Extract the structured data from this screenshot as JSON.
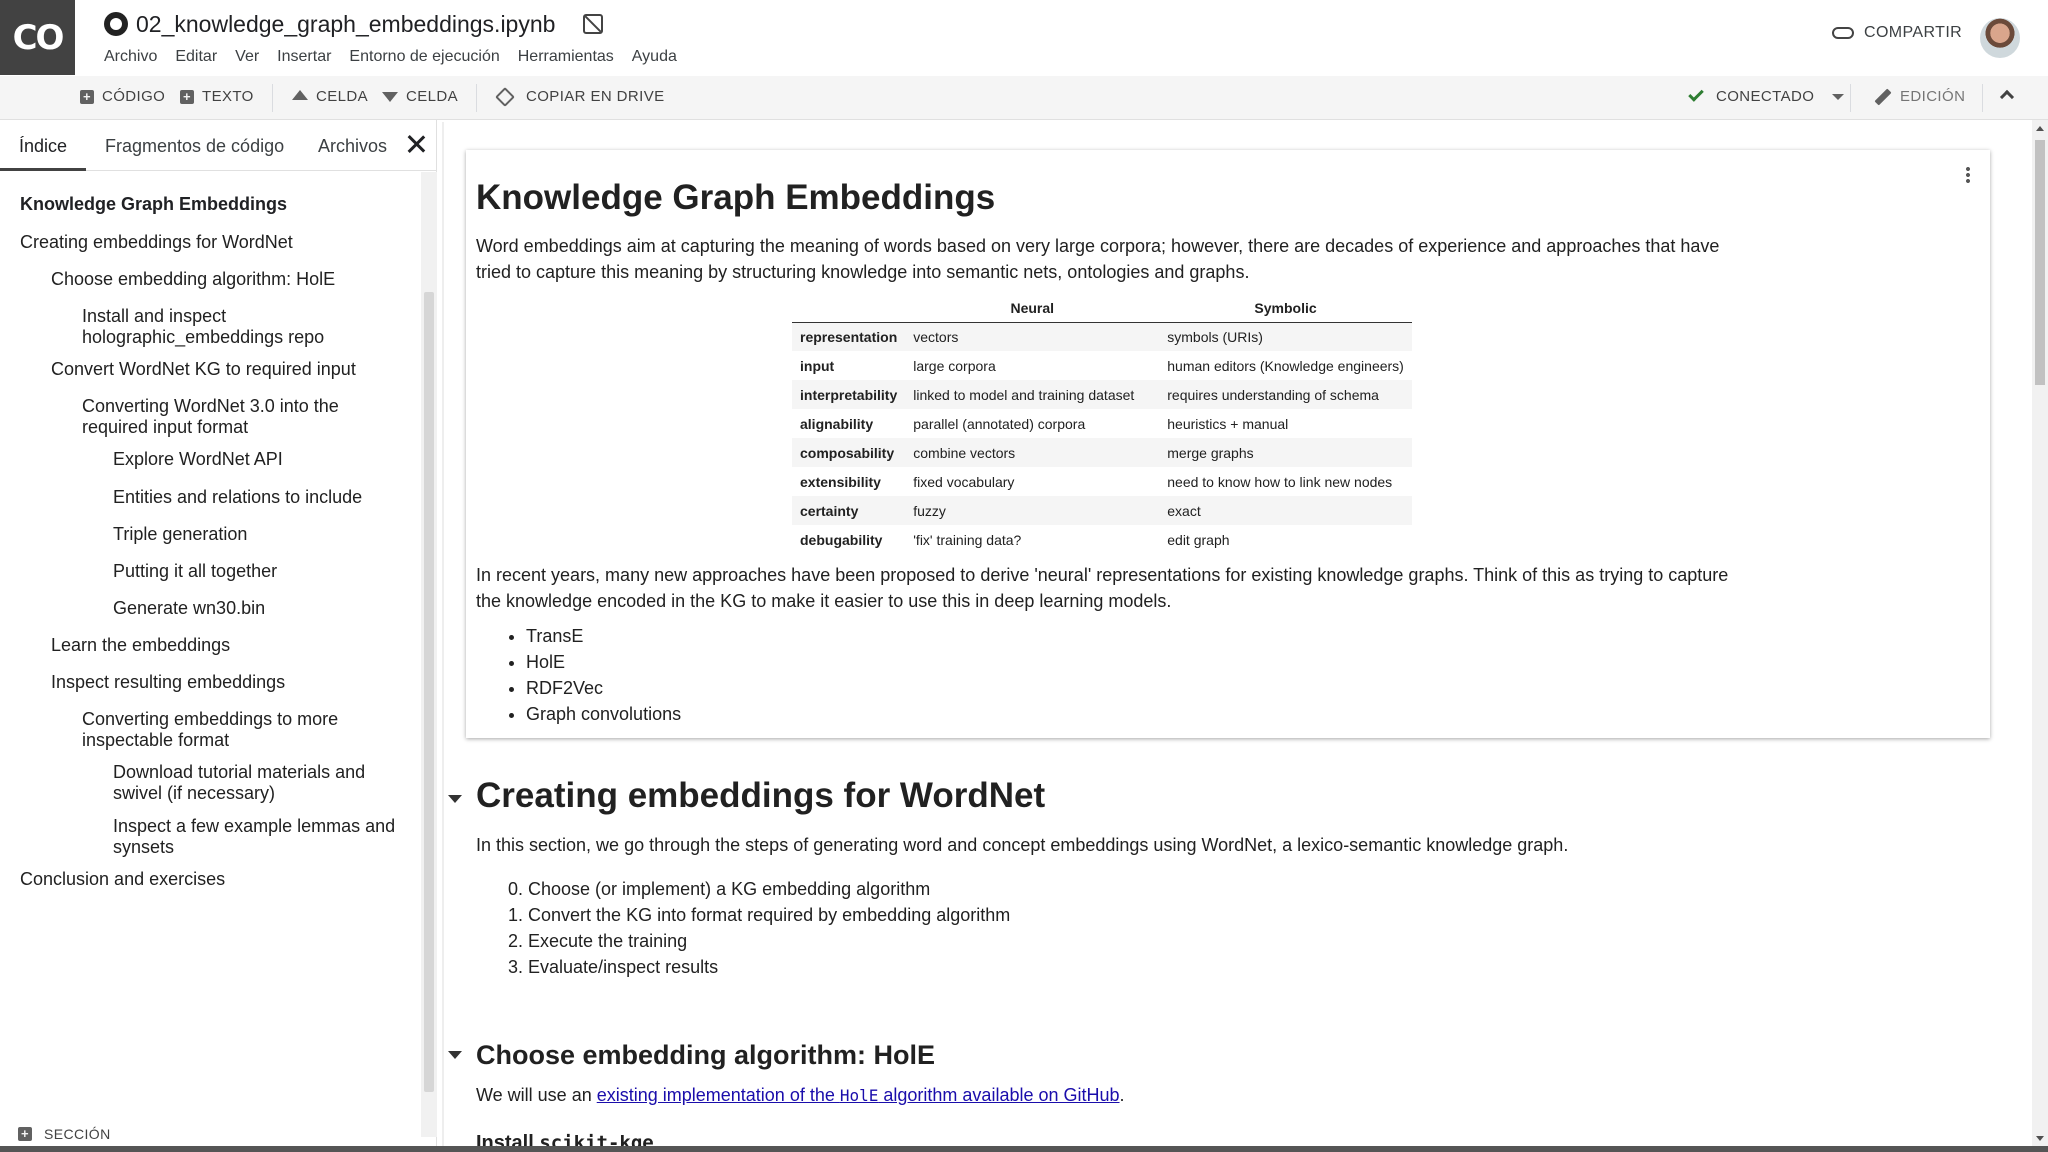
{
  "header": {
    "logo": "CO",
    "notebook_title": "02_knowledge_graph_embeddings.ipynb",
    "menu": [
      "Archivo",
      "Editar",
      "Ver",
      "Insertar",
      "Entorno de ejecución",
      "Herramientas",
      "Ayuda"
    ],
    "share_label": "COMPARTIR"
  },
  "toolbar": {
    "code_label": "CÓDIGO",
    "text_label": "TEXTO",
    "cell_up_label": "CELDA",
    "cell_down_label": "CELDA",
    "copy_drive_label": "COPIAR EN DRIVE",
    "connected_label": "CONECTADO",
    "edit_label": "EDICIÓN"
  },
  "sidebar": {
    "tabs": [
      "Índice",
      "Fragmentos de código",
      "Archivos"
    ],
    "toc": [
      {
        "label": "Knowledge Graph Embeddings",
        "level": 0,
        "bold": true
      },
      {
        "label": "Creating embeddings for WordNet",
        "level": 0
      },
      {
        "label": "Choose embedding algorithm: HolE",
        "level": 1
      },
      {
        "label": "Install and inspect holographic_embeddings repo",
        "level": 2
      },
      {
        "label": "Convert WordNet KG to required input",
        "level": 1
      },
      {
        "label": "Converting WordNet 3.0 into the required input format",
        "level": 2
      },
      {
        "label": "Explore WordNet API",
        "level": 3
      },
      {
        "label": "Entities and relations to include",
        "level": 3
      },
      {
        "label": "Triple generation",
        "level": 3
      },
      {
        "label": "Putting it all together",
        "level": 3
      },
      {
        "label": "Generate wn30.bin",
        "level": 3
      },
      {
        "label": "Learn the embeddings",
        "level": 1
      },
      {
        "label": "Inspect resulting embeddings",
        "level": 1
      },
      {
        "label": "Converting embeddings to more inspectable format",
        "level": 2
      },
      {
        "label": "Download tutorial materials and swivel (if necessary)",
        "level": 3
      },
      {
        "label": "Inspect a few example lemmas and synsets",
        "level": 3
      },
      {
        "label": "Conclusion and exercises",
        "level": 0
      }
    ],
    "section_label": "SECCIÓN"
  },
  "main": {
    "title": "Knowledge Graph Embeddings",
    "intro": "Word embeddings aim at capturing the meaning of words based on very large corpora; however, there are decades of experience and approaches that have tried to capture this meaning by structuring knowledge into semantic nets, ontologies and graphs.",
    "table": {
      "headers": [
        "",
        "Neural",
        "Symbolic"
      ],
      "rows": [
        [
          "representation",
          "vectors",
          "symbols (URIs)"
        ],
        [
          "input",
          "large corpora",
          "human editors (Knowledge engineers)"
        ],
        [
          "interpretability",
          "linked to model and training dataset",
          "requires understanding of schema"
        ],
        [
          "alignability",
          "parallel (annotated) corpora",
          "heuristics + manual"
        ],
        [
          "composability",
          "combine vectors",
          "merge graphs"
        ],
        [
          "extensibility",
          "fixed vocabulary",
          "need to know how to link new nodes"
        ],
        [
          "certainty",
          "fuzzy",
          "exact"
        ],
        [
          "debugability",
          "'fix' training data?",
          "edit graph"
        ]
      ]
    },
    "recent": "In recent years, many new approaches have been proposed to derive 'neural' representations for existing knowledge graphs. Think of this as trying to capture the knowledge encoded in the KG to make it easier to use this in deep learning models.",
    "bullets": [
      "TransE",
      "HolE",
      "RDF2Vec",
      "Graph convolutions"
    ],
    "section2_title": "Creating embeddings for WordNet",
    "section2_text": "In this section, we go through the steps of generating word and concept embeddings using WordNet, a lexico-semantic knowledge graph.",
    "steps": [
      "0. Choose (or implement) a KG embedding algorithm",
      "1. Convert the KG into format required by embedding algorithm",
      "2. Execute the training",
      "3. Evaluate/inspect results"
    ],
    "section3_title": "Choose embedding algorithm: HolE",
    "section3_prefix": "We will use an ",
    "section3_link_a": "existing implementation of the ",
    "section3_link_code": "HolE",
    "section3_link_b": " algorithm available on GitHub",
    "section3_suffix": ".",
    "section4_title_a": "Install ",
    "section4_title_code": "scikit-kge"
  }
}
